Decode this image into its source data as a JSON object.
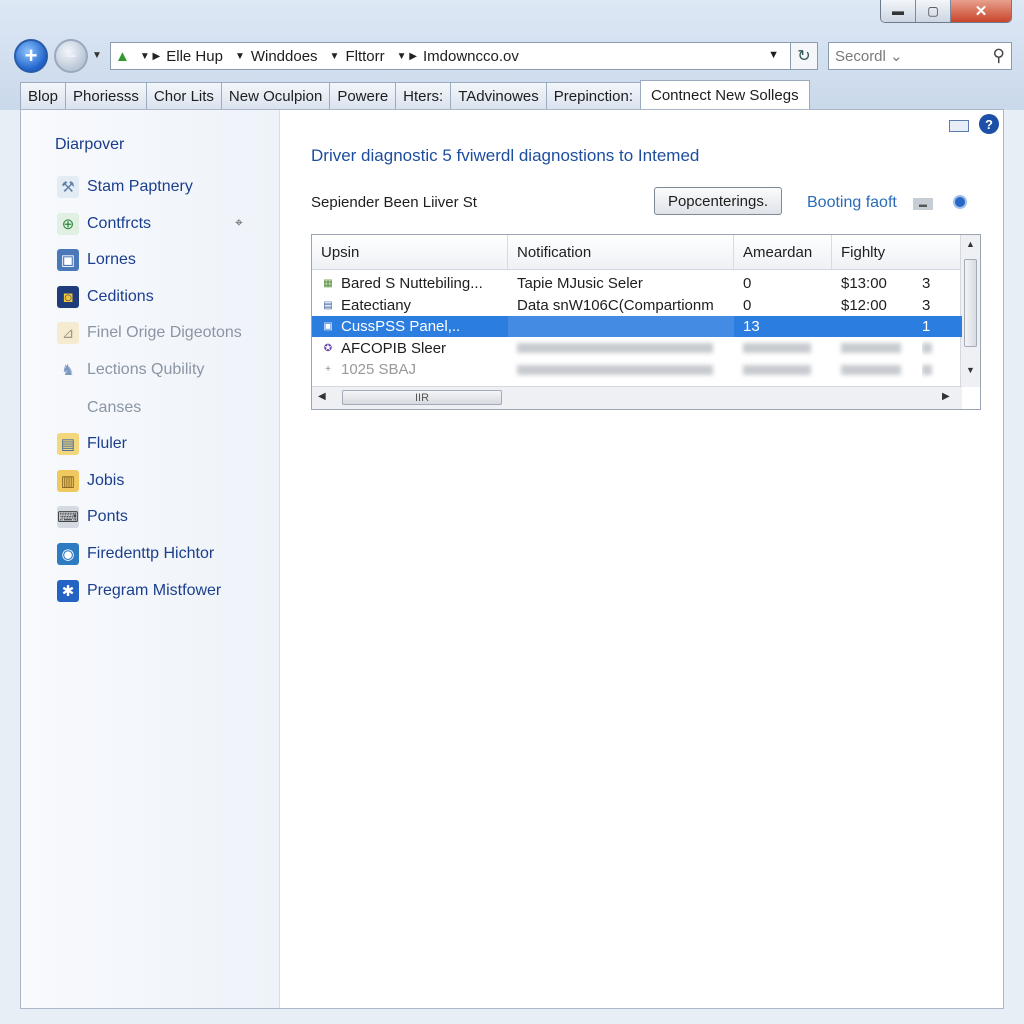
{
  "window": {
    "min_glyph": "▬",
    "max_glyph": "▢",
    "close_glyph": "✕"
  },
  "nav": {
    "back_glyph": "+",
    "forward_glyph": "−",
    "dropdown_glyph": "▼",
    "address_segments": [
      "Elle Hup",
      "Winddoes",
      "Flttorr",
      "Imdowncco.ov"
    ],
    "refresh_glyph": "↻",
    "search_placeholder": "Secordl ⌄",
    "search_glyph": "⚲"
  },
  "tabs": [
    {
      "label": "Blop",
      "active": false
    },
    {
      "label": "Phoriesss",
      "active": false
    },
    {
      "label": "Chor Lits",
      "active": false
    },
    {
      "label": "New Oculpion",
      "active": false
    },
    {
      "label": "Powere",
      "active": false
    },
    {
      "label": "Hters:",
      "active": false
    },
    {
      "label": "TAdvinowes",
      "active": false
    },
    {
      "label": "Prepinction:",
      "active": false
    },
    {
      "label": "Contnect New Sollegs",
      "active": true
    }
  ],
  "sidebar": {
    "title": "Diarpover",
    "items": [
      {
        "label": "Stam Paptnery",
        "icon": "tools-icon",
        "dim": false
      },
      {
        "label": "Contfrcts",
        "icon": "globe-icon",
        "dim": false
      },
      {
        "label": "Lornes",
        "icon": "picture-icon",
        "dim": false
      },
      {
        "label": "Ceditions",
        "icon": "jar-icon",
        "dim": false
      },
      {
        "label": "Finel Orige Digeotons",
        "icon": "chart-icon",
        "dim": true
      },
      {
        "label": "Lections Qubility",
        "icon": "people-icon",
        "dim": true
      },
      {
        "label": "Canses",
        "icon": "",
        "dim": true
      },
      {
        "label": "Fluler",
        "icon": "folder-icon",
        "dim": false
      },
      {
        "label": "Jobis",
        "icon": "folders-icon",
        "dim": false
      },
      {
        "label": "Ponts",
        "icon": "laptop-icon",
        "dim": false
      },
      {
        "label": "Firedenttp Hichtor",
        "icon": "earth-icon",
        "dim": false
      },
      {
        "label": "Pregram Mistfower",
        "icon": "bluetooth-icon",
        "dim": false
      }
    ],
    "pin_glyph": "⌖"
  },
  "main": {
    "title": "Driver diagnostic 5 fviwerdl diagnostions to Intemed",
    "subtitle": "Sepiender Been Liiver St",
    "button_label": "Popcenterings.",
    "link_label": "Booting faoft",
    "help_glyph": "?"
  },
  "grid": {
    "columns": [
      "Upsin",
      "Notification",
      "Ameardan",
      "Fighlty"
    ],
    "rows": [
      {
        "name": "Bared S Nuttebiling...",
        "notification": "Tapie MJusic Seler",
        "amount": "0",
        "price": "$13:00",
        "count": "3",
        "state": "normal"
      },
      {
        "name": "Eatectiany",
        "notification": "Data snW106C(Compartionm",
        "amount": "0",
        "price": "$12:00",
        "count": "3",
        "state": "normal"
      },
      {
        "name": "CussPSS Panel,..",
        "notification": "",
        "amount": "13",
        "price": "",
        "count": "1",
        "state": "selected"
      },
      {
        "name": "AFCOPIB Sleer",
        "notification": "",
        "amount": "",
        "price": "",
        "count": "",
        "state": "blurred"
      },
      {
        "name": "1025 SBAJ",
        "notification": "",
        "amount": "",
        "price": "",
        "count": "",
        "state": "blurred"
      }
    ],
    "hscroll_label": "IIR",
    "up_glyph": "▲",
    "down_glyph": "▼",
    "left_glyph": "◀",
    "right_glyph": "▶"
  }
}
